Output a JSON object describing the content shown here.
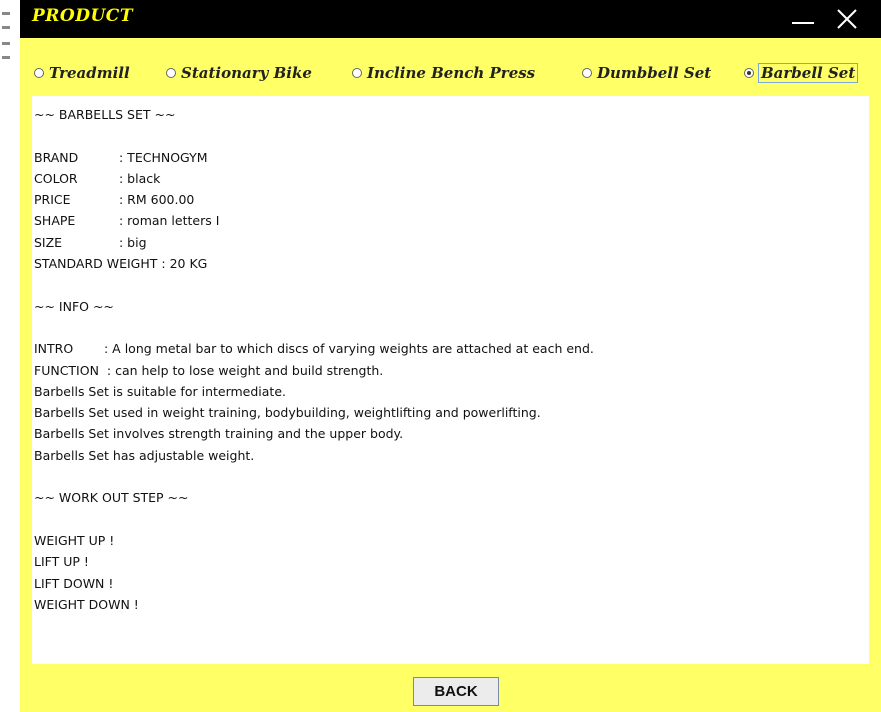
{
  "window": {
    "title": "PRODUCT",
    "colors": {
      "titlebar": "#000000",
      "title_text": "#ffff00",
      "background": "#ffff66",
      "content": "#ffffff"
    }
  },
  "tabs": [
    {
      "label": "Treadmill",
      "selected": false
    },
    {
      "label": "Stationary Bike",
      "selected": false
    },
    {
      "label": "Incline Bench Press",
      "selected": false
    },
    {
      "label": "Dumbbell Set",
      "selected": false
    },
    {
      "label": "Barbell Set",
      "selected": true
    }
  ],
  "content": {
    "header": "~~ BARBELLS SET ~~",
    "specs": [
      {
        "key": "BRAND",
        "value": ": TECHNOGYM"
      },
      {
        "key": "COLOR",
        "value": ": black"
      },
      {
        "key": "PRICE",
        "value": ": RM 600.00"
      },
      {
        "key": "SHAPE",
        "value": ": roman letters I"
      },
      {
        "key": "SIZE",
        "value": ": big"
      }
    ],
    "standard_weight": "STANDARD WEIGHT : 20 KG",
    "info_header": "~~ INFO ~~",
    "intro": {
      "key": "INTRO",
      "value": ": A long metal bar to which discs of varying weights are attached at each end."
    },
    "function": {
      "key": "FUNCTION",
      "value": ": can help to lose weight and build strength."
    },
    "info_lines": [
      "Barbells Set is suitable for intermediate.",
      "Barbells Set used in weight training, bodybuilding, weightlifting and powerlifting.",
      "Barbells Set involves strength training and the upper body.",
      "Barbells Set has adjustable weight."
    ],
    "workout_header": "~~ WORK OUT STEP ~~",
    "steps": [
      "WEIGHT UP !",
      "LIFT UP !",
      "LIFT DOWN !",
      "WEIGHT DOWN !"
    ]
  },
  "back_label": "BACK"
}
